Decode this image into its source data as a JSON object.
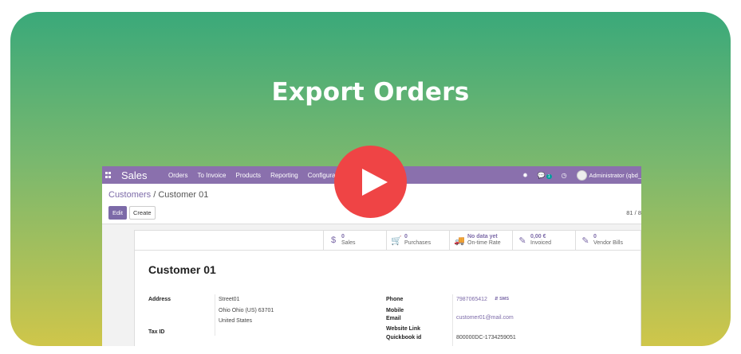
{
  "headline": "Export Orders",
  "navbar": {
    "app_title": "Sales",
    "menu": [
      "Orders",
      "To Invoice",
      "Products",
      "Reporting",
      "Configuration"
    ],
    "chat_count": "1",
    "user": "Administrator (qbd_"
  },
  "breadcrumb": {
    "parent": "Customers",
    "separator": " / ",
    "current": "Customer 01"
  },
  "buttons": {
    "edit": "Edit",
    "create": "Create"
  },
  "pager": "81 / 8",
  "stats": [
    {
      "icon": "dollar-icon",
      "glyph": "$",
      "value": "0",
      "label": "Sales"
    },
    {
      "icon": "cart-icon",
      "glyph": "🛒",
      "value": "0",
      "label": "Purchases"
    },
    {
      "icon": "truck-icon",
      "glyph": "🚚",
      "value": "No data yet",
      "label": "On-time Rate"
    },
    {
      "icon": "invoice-icon",
      "glyph": "✎",
      "value": "0,00 €",
      "label": "Invoiced"
    },
    {
      "icon": "vendor-bill-icon",
      "glyph": "✎",
      "value": "0",
      "label": "Vendor Bills"
    }
  ],
  "customer": {
    "name": "Customer 01",
    "address_label": "Address",
    "address_lines": [
      "Street01",
      "Ohio  Ohio (US)  63701",
      "United States"
    ],
    "tax_label": "Tax ID",
    "phone_label": "Phone",
    "phone": "7987065412",
    "sms": "SMS",
    "mobile_label": "Mobile",
    "email_label": "Email",
    "email": "customer01@mail.com",
    "website_label": "Website Link",
    "quickbook_label": "Quickbook id",
    "quickbook": "800000DC-1734259051"
  },
  "colors": {
    "brand": "#8a70ad",
    "accent": "#7c6aa8",
    "play": "#ef4445"
  }
}
